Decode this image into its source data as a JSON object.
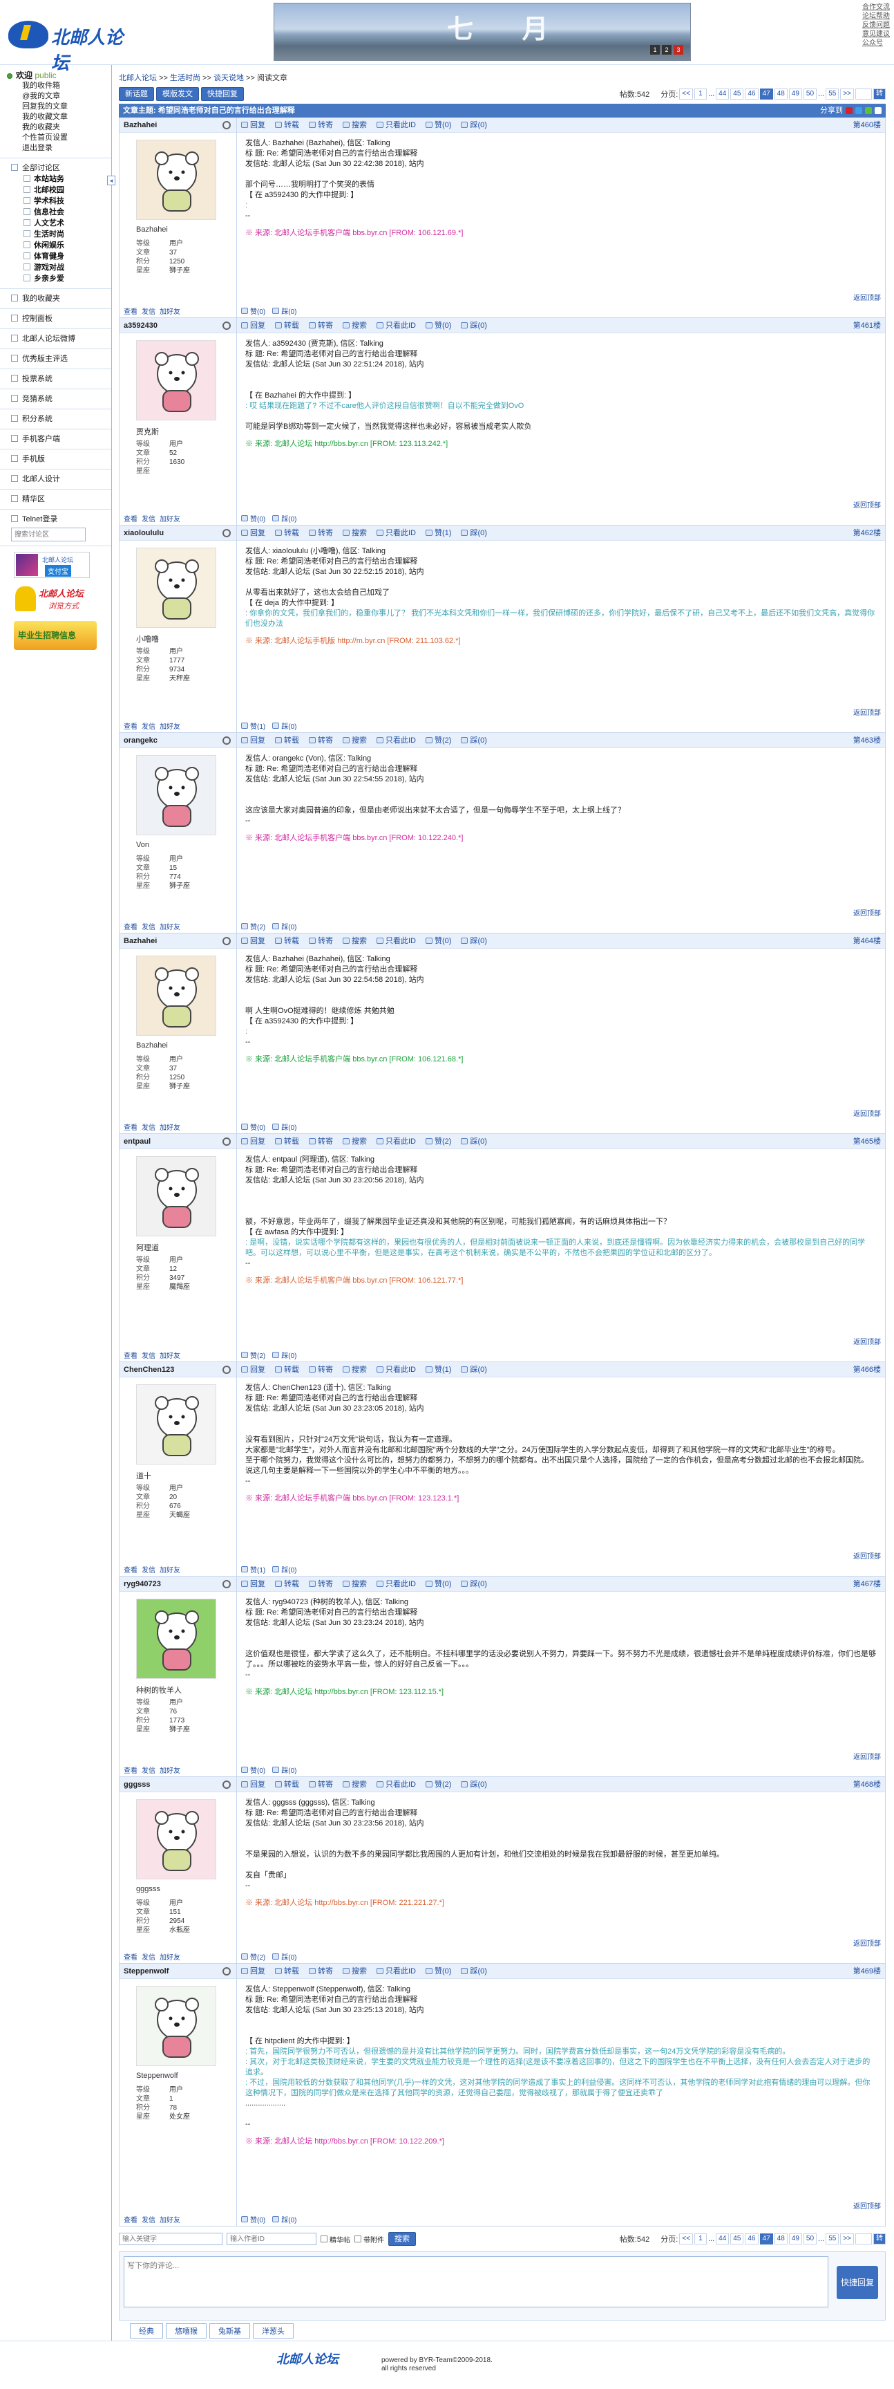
{
  "header": {
    "logo_text": "北邮人论坛",
    "banner_text": "七 月",
    "banner_dots": [
      "1",
      "2",
      "3"
    ],
    "top_links": [
      "合作交流",
      "论坛帮助",
      "反馈问题",
      "意见建议",
      "公众号"
    ]
  },
  "sidebar": {
    "welcome": "欢迎",
    "user": "public",
    "links": [
      "我的收件箱",
      "@我的文章",
      "回复我的文章",
      "我的收藏文章",
      "我的收藏夹",
      "个性首页设置",
      "退出登录"
    ],
    "all_boards": "全部讨论区",
    "boards": [
      "本站站务",
      "北邮校园",
      "学术科技",
      "信息社会",
      "人文艺术",
      "生活时尚",
      "休闲娱乐",
      "体育健身",
      "游戏对战",
      "乡亲乡爱"
    ],
    "sections": [
      "我的收藏夹",
      "控制面板",
      "北邮人论坛微博",
      "优秀版主评选",
      "投票系统",
      "竞猜系统",
      "积分系统",
      "手机客户端",
      "手机版",
      "北邮人设计",
      "精华区",
      "Telnet登录"
    ],
    "search_placeholder": "搜索讨论区",
    "ad1": "北邮人论坛",
    "ad1_sub": "支付宝",
    "ad2": "北邮人论坛",
    "ad2_sub": "浏览方式",
    "ad3": "毕业生招聘信息"
  },
  "crumb": {
    "items": [
      "北邮人论坛",
      ">>",
      "生活时尚",
      ">>",
      "谈天说地",
      ">>",
      "阅读文章"
    ]
  },
  "toolbar": {
    "new_post": "新话题",
    "mode": "模版发文",
    "quick_reply": "快捷回复",
    "count_label": "帖数:542",
    "pages_label": "分页:",
    "pages": [
      "<<",
      "1",
      "...",
      "44",
      "45",
      "46",
      "47",
      "48",
      "49",
      "50",
      "...",
      "55",
      ">>"
    ],
    "current_page": "47",
    "go": "转"
  },
  "thread": {
    "title": "文章主题: 希望同浩老师对自己的言行给出合理解释",
    "share": "分享到"
  },
  "post_tools": {
    "reply": "回复",
    "forward": "转载",
    "repost": "转寄",
    "search": "搜索",
    "only": "只看此ID",
    "like": "赞",
    "dislike": "踩",
    "totop": "返回顶部",
    "query": "查看",
    "mail": "发信",
    "friend": "加好友"
  },
  "stat_labels": {
    "level": "等级",
    "posts": "文章",
    "score": "积分",
    "constellation": "星座"
  },
  "posts": [
    {
      "user": "Bazhahei",
      "nick": "Bazhahei",
      "level": "用户",
      "posts": "37",
      "score": "1250",
      "star": "狮子座",
      "floor": "第460楼",
      "like": "赞(0)",
      "dislike": "踩(0)",
      "lines": [
        "发信人: Bazhahei (Bazhahei), 信区: Talking",
        "标  题: Re: 希望同浩老师对自己的言行给出合理解释",
        "发信站: 北邮人论坛 (Sat Jun 30 22:42:38 2018), 站内"
      ],
      "content": [
        "那个问号……我明明打了个笑哭的表情",
        "【 在 a3592430 的大作中提到: 】",
        ":",
        "--"
      ],
      "src": "※ 来源: 北邮人论坛手机客户端 bbs.byr.cn [FROM: 106.121.69.*]"
    },
    {
      "user": "a3592430",
      "nick": "贾克斯",
      "level": "用户",
      "posts": "52",
      "score": "1630",
      "star": "",
      "floor": "第461楼",
      "like": "赞(0)",
      "dislike": "踩(0)",
      "lines": [
        "发信人: a3592430 (贾克斯), 信区: Talking",
        "标  题: Re: 希望同浩老师对自己的言行给出合理解释",
        "发信站: 北邮人论坛 (Sat Jun 30 22:51:24 2018), 站内"
      ],
      "content": [
        "",
        "【 在 Bazhahei 的大作中提到: 】",
        ": 哎 结果现在跑题了? 不过不care他人评价这段自信很赞啊！自以不能完全做到OvO",
        "",
        "可能是同学B绑劝等到一定火候了，当然我觉得这样也未必好，容易被当成老实人欺负"
      ],
      "src": "※ 来源: 北邮人论坛 http://bbs.byr.cn [FROM: 123.113.242.*]"
    },
    {
      "user": "xiaoloululu",
      "nick": "小噜噜",
      "level": "用户",
      "posts": "1777",
      "score": "9734",
      "star": "天秤座",
      "floor": "第462楼",
      "like": "赞(1)",
      "dislike": "踩(0)",
      "lines": [
        "发信人: xiaoloululu (小噜噜), 信区: Talking",
        "标  题: Re: 希望同浩老师对自己的言行给出合理解释",
        "发信站: 北邮人论坛 (Sat Jun 30 22:52:15 2018), 站内"
      ],
      "content": [
        "从零看出来就好了，这也太会给自己加戏了",
        "【 在 deja 的大作中提到: 】",
        ": 你拿你的文凭，我们拿我们的，稳重你事儿了？ 我们不光本科文凭和你们一样一样，我们保研博硕的还多，你们学院好，最后保不了研，自己又考不上，最后还不如我们文凭高，真觉得你们也没办法"
      ],
      "src": "※ 来源: 北邮人论坛手机版 http://m.byr.cn [FROM: 211.103.62.*]"
    },
    {
      "user": "orangekc",
      "nick": "Von",
      "level": "用户",
      "posts": "15",
      "score": "774",
      "star": "狮子座",
      "floor": "第463楼",
      "like": "赞(2)",
      "dislike": "踩(0)",
      "lines": [
        "发信人: orangekc (Von), 信区: Talking",
        "标  题: Re: 希望同浩老师对自己的言行给出合理解释",
        "发信站: 北邮人论坛 (Sat Jun 30 22:54:55 2018), 站内"
      ],
      "content": [
        "",
        "这应该是大家对奥园普遍的印象，但是由老师说出来就不太合适了，但是一句侮辱学生不至于吧，太上纲上线了？",
        "--"
      ],
      "src": "※ 来源: 北邮人论坛手机客户端 bbs.byr.cn [FROM: 10.122.240.*]"
    },
    {
      "user": "Bazhahei",
      "nick": "Bazhahei",
      "level": "用户",
      "posts": "37",
      "score": "1250",
      "star": "狮子座",
      "floor": "第464楼",
      "like": "赞(0)",
      "dislike": "踩(0)",
      "lines": [
        "发信人: Bazhahei (Bazhahei), 信区: Talking",
        "标  题: Re: 希望同浩老师对自己的言行给出合理解释",
        "发信站: 北邮人论坛 (Sat Jun 30 22:54:58 2018), 站内"
      ],
      "content": [
        "",
        "啊 人生啊OvO挺难得的！继续修炼 共勉共勉",
        "【 在 a3592430 的大作中提到: 】",
        ":",
        "--"
      ],
      "src": "※ 来源: 北邮人论坛手机客户端 bbs.byr.cn [FROM: 106.121.68.*]"
    },
    {
      "user": "entpaul",
      "nick": "阿理道",
      "level": "用户",
      "posts": "12",
      "score": "3497",
      "star": "魔羯座",
      "floor": "第465楼",
      "like": "赞(2)",
      "dislike": "踩(0)",
      "lines": [
        "发信人: entpaul (阿理道), 信区: Talking",
        "标  题: Re: 希望同浩老师对自己的言行给出合理解释",
        "发信站: 北邮人论坛 (Sat Jun 30 23:20:56 2018), 站内"
      ],
      "content": [
        "",
        "",
        "额，不好意思，毕业两年了，缀我了解果园毕业证还真没和其他院的有区别呢，可能我们孤陋寡闻，有的话麻烦具体指出一下？",
        "【 在 awfasa 的大作中提到: 】",
        ": 是啊，没错，说实话哪个学院都有这样的，果园也有很优秀的人，但是相对前面被说来一顿正面的人来说，到底还是懂得啊。因为依靠经济实力得来的机会，会被那校是到自己好的同学吧。可以这样想，可以说心里不平衡，但是这是事实，在高考这个机制来说，确实是不公平的，不然也不会把果园的学位证和北邮的区分了。",
        "--"
      ],
      "src": "※ 来源: 北邮人论坛手机客户端 bbs.byr.cn [FROM: 106.121.77.*]"
    },
    {
      "user": "ChenChen123",
      "nick": "道十",
      "level": "用户",
      "posts": "20",
      "score": "676",
      "star": "天蝎座",
      "floor": "第466楼",
      "like": "赞(1)",
      "dislike": "踩(0)",
      "lines": [
        "发信人: ChenChen123 (道十), 信区: Talking",
        "标  题: Re: 希望同浩老师对自己的言行给出合理解释",
        "发信站: 北邮人论坛 (Sat Jun 30 23:23:05 2018), 站内"
      ],
      "content": [
        "",
        "没有看到图片，只针对\"24万文凭\"说句话，我认为有一定道理。",
        "大家都是\"北邮学生\"，对外人而言并没有北邮和北邮国院\"两个分数线的大学\"之分。24万使国际学生的入学分数起点变低，却得到了和其他学院一样的文凭和\"北邮毕业生\"的称号。",
        "至于哪个院努力，我觉得这个没什么可比的，想努力的都努力，不想努力的哪个院都有。出不出国只是个人选择，国院给了一定的合作机会，但是高考分数超过北邮的也不会报北邮国院。",
        "说这几句主要是解释一下一些国院以外的学生心中不平衡的地方。。。",
        "--"
      ],
      "src": "※ 来源: 北邮人论坛手机客户端 bbs.byr.cn [FROM: 123.123.1.*]"
    },
    {
      "user": "ryg940723",
      "nick": "种树的牧羊人",
      "level": "用户",
      "posts": "76",
      "score": "1773",
      "star": "狮子座",
      "floor": "第467楼",
      "like": "赞(0)",
      "dislike": "踩(0)",
      "lines": [
        "发信人: ryg940723 (种树的牧羊人), 信区: Talking",
        "标  题: Re: 希望同浩老师对自己的言行给出合理解释",
        "发信站: 北邮人论坛 (Sat Jun 30 23:23:24 2018), 站内"
      ],
      "content": [
        "",
        "这价值观也是很怪，都大学读了这么久了，还不能明白。不挂科哪里学的话没必要说别人不努力，异要踩一下。努不努力不光是成绩，很遗憾社会并不是单纯程度成绩评价标准，你们也是够了。。。所以哪被吃的姿势水平高一些，惊人的好好自己反省一下。。。",
        "--"
      ],
      "src": "※ 来源: 北邮人论坛 http://bbs.byr.cn [FROM: 123.112.15.*]"
    },
    {
      "user": "gggsss",
      "nick": "gggsss",
      "level": "用户",
      "posts": "151",
      "score": "2954",
      "star": "水瓶座",
      "floor": "第468楼",
      "like": "赞(2)",
      "dislike": "踩(0)",
      "lines": [
        "发信人: gggsss (gggsss), 信区: Talking",
        "标  题: Re: 希望同浩老师对自己的言行给出合理解释",
        "发信站: 北邮人论坛 (Sat Jun 30 23:23:56 2018), 站内"
      ],
      "content": [
        "",
        "不是果园的入想说，认识的为数不多的果园同学都比我周围的人更加有计划，和他们交流相处的时候是我在我卸最舒服的时候，甚至更加单纯。",
        "",
        "发自「贵邮」",
        "--"
      ],
      "src": "※ 来源: 北邮人论坛 http://bbs.byr.cn [FROM: 221.221.27.*]"
    },
    {
      "user": "Steppenwolf",
      "nick": "Steppenwolf",
      "level": "用户",
      "posts": "1",
      "score": "78",
      "star": "处女座",
      "floor": "第469楼",
      "like": "赞(0)",
      "dislike": "踩(0)",
      "lines": [
        "发信人: Steppenwolf (Steppenwolf), 信区: Talking",
        "标  题: Re: 希望同浩老师对自己的言行给出合理解释",
        "发信站: 北邮人论坛 (Sat Jun 30 23:25:13 2018), 站内"
      ],
      "content": [
        "",
        "【 在 hitpclient 的大作中提到: 】",
        ": 首先，国院同学很努力不可否认，但很遗憾的是并没有比其他学院的同学更努力。同时，国院学费高分数低却是事实，这一句24万文凭学院的彩容是没有毛病的。",
        ": 其次，对于北邮这类极顶财经来说，学生要的文凭就业能力较竞是一个理性的选择(这是该不要凉着这回事的)，但这之下的国院学生也在不平衡上选择，没有任何人会去否定人对于进步的追求。",
        ": 不过，国院用较低的分数获取了和其他同学(几乎)一样的文凭，这对其他学院的同学造成了事实上的利益侵害。这同样不可否认，其他学院的老师同学对此抱有情绪的理由可以理解。但你这种情况下，国院的同学们做众是来在选择了其他同学的资源，还觉得自己委屈，觉得被歧视了，那就属于得了便宜还卖乖了",
        "...................",
        "",
        "--"
      ],
      "src": "※ 来源: 北邮人论坛 http://bbs.byr.cn [FROM: 10.122.209.*]"
    }
  ],
  "bottom": {
    "search_placeholder": "输入关键字",
    "author_placeholder": "输入作者ID",
    "check1": "精华帖",
    "check2": "带附件",
    "search_btn": "搜索"
  },
  "reply": {
    "placeholder": "写下你的评论...",
    "submit": "快捷回复",
    "tabs": [
      "经典",
      "悠嘻猴",
      "兔斯基",
      "洋葱头"
    ]
  },
  "footer": {
    "logo": "北邮人论坛",
    "line1": "powered by BYR-Team©2009-2018.",
    "line2": "all rights reserved"
  }
}
